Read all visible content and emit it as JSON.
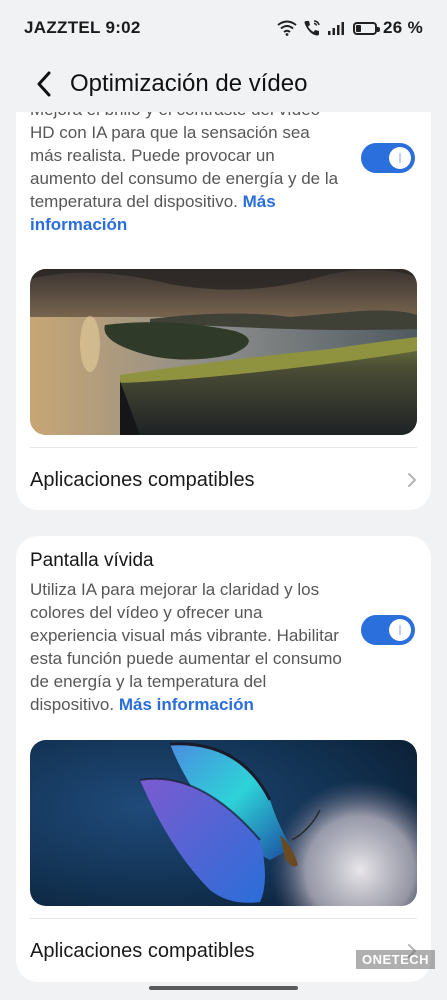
{
  "status_bar": {
    "carrier": "JAZZTEL",
    "time": "9:02",
    "battery": "26 %",
    "battery_level": 0.26,
    "icons": [
      "wifi-icon",
      "wifi-call-icon",
      "signal-icon",
      "battery-icon"
    ]
  },
  "header": {
    "back_icon": "chevron-left-icon",
    "title": "Optimización de vídeo"
  },
  "section1": {
    "desc_partial_top": "Mejora el brillo y el contraste del",
    "desc": "vídeo HD con IA para que la sensación sea más realista. Puede provocar un aumento del consumo de energía y de la temperatura del dispositivo.",
    "more_link": "Más información",
    "toggle_on": true,
    "preview_image": "landscape-cliff-lake-sunset",
    "compatible_label": "Aplicaciones compatibles"
  },
  "section2": {
    "title": "Pantalla vívida",
    "desc": "Utiliza IA para mejorar la claridad y los colores del vídeo y ofrecer una experiencia visual más vibrante. Habilitar esta función puede aumentar el consumo de energía y la temperatura del dispositivo.",
    "more_link": "Más información",
    "toggle_on": true,
    "preview_image": "blue-butterfly-dandelion",
    "compatible_label": "Aplicaciones compatibles"
  },
  "watermark": "ONETECH",
  "colors": {
    "accent": "#2b6fdd",
    "link": "#2a6edb",
    "background": "#f1f2f4",
    "card": "#ffffff"
  }
}
